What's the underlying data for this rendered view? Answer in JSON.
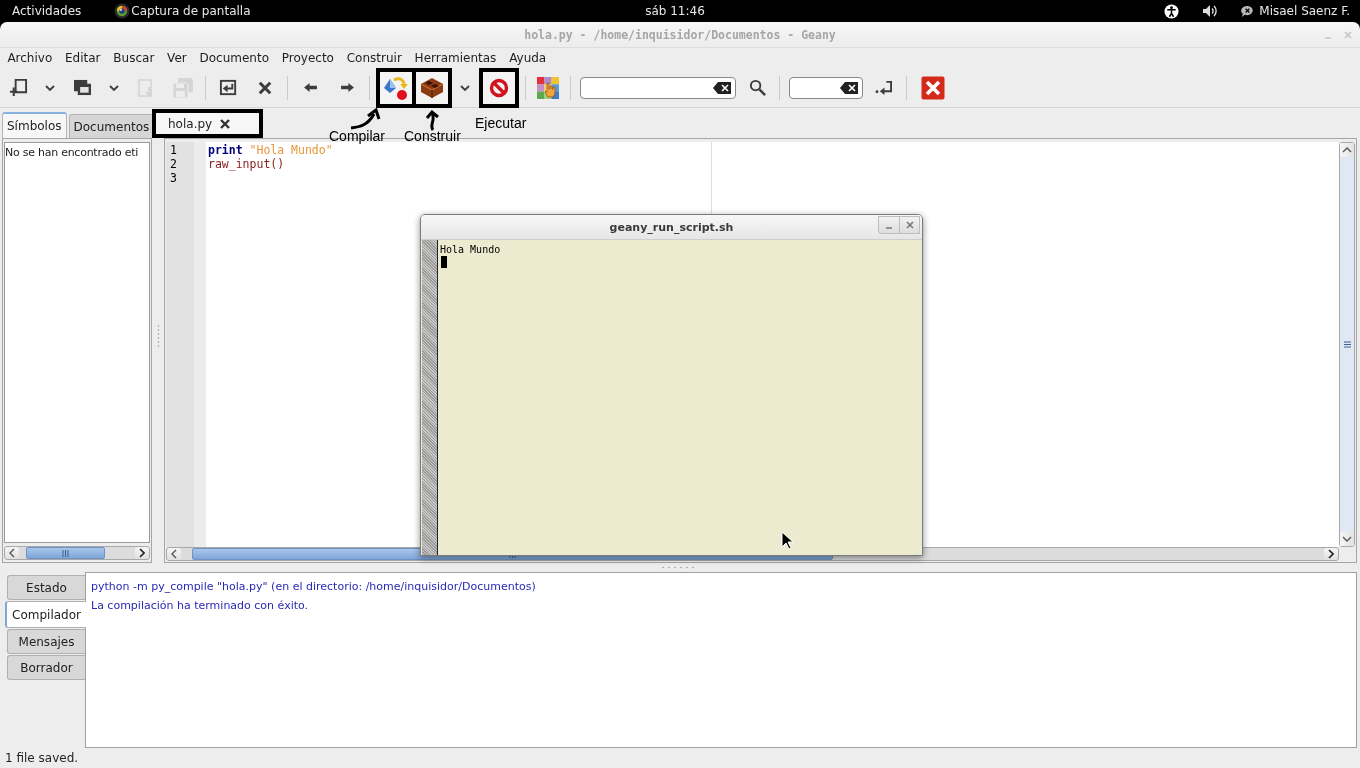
{
  "top_bar": {
    "activities": "Actividades",
    "app_menu": "Captura de pantalla",
    "clock": "sáb 11:46",
    "user": "Misael Saenz F."
  },
  "window": {
    "title": "hola.py - /home/inquisidor/Documentos - Geany"
  },
  "menu": [
    "Archivo",
    "Editar",
    "Buscar",
    "Ver",
    "Documento",
    "Proyecto",
    "Construir",
    "Herramientas",
    "Ayuda"
  ],
  "toolbar": [
    [
      {
        "kind": "new",
        "disabled": false,
        "highlighted": false
      },
      {
        "kind": "dropdown",
        "disabled": false,
        "highlighted": false
      },
      {
        "kind": "open",
        "disabled": false,
        "highlighted": false
      },
      {
        "kind": "dropdown",
        "disabled": false,
        "highlighted": false
      },
      {
        "kind": "save",
        "disabled": true,
        "highlighted": false
      },
      {
        "kind": "saveall",
        "disabled": true,
        "highlighted": false
      }
    ],
    [
      {
        "kind": "revert",
        "disabled": false,
        "highlighted": false
      },
      {
        "kind": "close",
        "disabled": false,
        "highlighted": false
      }
    ],
    [
      {
        "kind": "back",
        "disabled": false,
        "highlighted": false
      },
      {
        "kind": "forward",
        "disabled": false,
        "highlighted": false
      }
    ],
    [
      {
        "kind": "compile",
        "disabled": false,
        "highlighted": true
      },
      {
        "kind": "build",
        "disabled": false,
        "highlighted": true
      },
      {
        "kind": "dropdown",
        "disabled": false,
        "highlighted": false
      },
      {
        "kind": "execute",
        "disabled": false,
        "highlighted": true
      }
    ],
    [
      {
        "kind": "color",
        "disabled": false,
        "highlighted": false
      }
    ],
    [
      {
        "kind": "searchfield",
        "disabled": false,
        "highlighted": false
      },
      {
        "kind": "find",
        "disabled": false,
        "highlighted": false
      }
    ],
    [
      {
        "kind": "gotofield",
        "disabled": false,
        "highlighted": false
      },
      {
        "kind": "jump",
        "disabled": false,
        "highlighted": false
      }
    ],
    [
      {
        "kind": "quit",
        "disabled": false,
        "highlighted": false
      }
    ]
  ],
  "callouts": [
    {
      "label": "Compilar",
      "kind": "arrow"
    },
    {
      "label": "Construir",
      "kind": "arrow"
    },
    {
      "label": "Ejecutar",
      "kind": "plain"
    }
  ],
  "sidebar": {
    "tabs": [
      {
        "label": "Símbolos",
        "selected": true
      },
      {
        "label": "Documentos",
        "selected": false
      }
    ],
    "message": "No se han encontrado eti"
  },
  "documents": {
    "tabs": [
      {
        "label": "hola.py",
        "selected": true,
        "highlighted": true
      }
    ]
  },
  "editor": {
    "lines": [
      {
        "number": "1",
        "tokens": [
          {
            "kind": "keyword",
            "text": "print"
          },
          {
            "kind": "string",
            "text": "\"Hola Mundo\""
          }
        ]
      },
      {
        "number": "2",
        "tokens": [
          {
            "kind": "identifier",
            "text": "raw_input()"
          }
        ]
      },
      {
        "number": "3"
      }
    ]
  },
  "run_window": {
    "title": "geany_run_script.sh",
    "output": [
      "Hola Mundo"
    ]
  },
  "messages": {
    "tabs": [
      {
        "label": "Estado",
        "selected": false
      },
      {
        "label": "Compilador",
        "selected": true
      },
      {
        "label": "Mensajes",
        "selected": false
      },
      {
        "label": "Borrador",
        "selected": false
      }
    ],
    "lines": [
      "python -m py_compile \"hola.py\" (en el directorio: /home/inquisidor/Documentos)",
      "La compilación ha terminado con éxito."
    ]
  },
  "status_bar": "1 file saved."
}
